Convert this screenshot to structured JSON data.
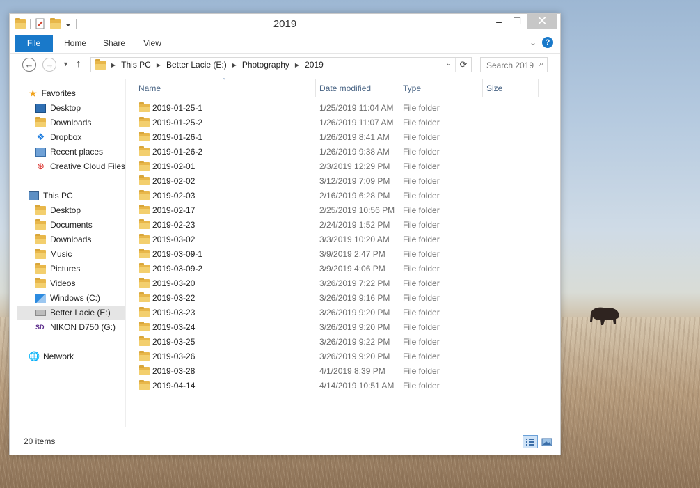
{
  "window": {
    "title": "2019",
    "minimize": "–",
    "maximize": "☐",
    "close": "✕"
  },
  "ribbon": {
    "tabs": [
      "File",
      "Home",
      "Share",
      "View"
    ],
    "accent": "#1979ca",
    "help": "?"
  },
  "nav": {
    "breadcrumbs": [
      "This PC",
      "Better Lacie (E:)",
      "Photography",
      "2019"
    ],
    "search_placeholder": "Search 2019"
  },
  "sidebar": {
    "favorites_header": "Favorites",
    "favorites": [
      "Desktop",
      "Downloads",
      "Dropbox",
      "Recent places",
      "Creative Cloud Files"
    ],
    "thispc_header": "This PC",
    "thispc": [
      "Desktop",
      "Documents",
      "Downloads",
      "Music",
      "Pictures",
      "Videos",
      "Windows (C:)",
      "Better Lacie (E:)",
      "NIKON D750  (G:)"
    ],
    "selected": "Better Lacie (E:)",
    "network_header": "Network"
  },
  "columns": {
    "name": "Name",
    "date": "Date modified",
    "type": "Type",
    "size": "Size"
  },
  "files": [
    {
      "name": "2019-01-25-1",
      "date": "1/25/2019 11:04 AM",
      "type": "File folder"
    },
    {
      "name": "2019-01-25-2",
      "date": "1/26/2019 11:07 AM",
      "type": "File folder"
    },
    {
      "name": "2019-01-26-1",
      "date": "1/26/2019 8:41 AM",
      "type": "File folder"
    },
    {
      "name": "2019-01-26-2",
      "date": "1/26/2019 9:38 AM",
      "type": "File folder"
    },
    {
      "name": "2019-02-01",
      "date": "2/3/2019 12:29 PM",
      "type": "File folder"
    },
    {
      "name": "2019-02-02",
      "date": "3/12/2019 7:09 PM",
      "type": "File folder"
    },
    {
      "name": "2019-02-03",
      "date": "2/16/2019 6:28 PM",
      "type": "File folder"
    },
    {
      "name": "2019-02-17",
      "date": "2/25/2019 10:56 PM",
      "type": "File folder"
    },
    {
      "name": "2019-02-23",
      "date": "2/24/2019 1:52 PM",
      "type": "File folder"
    },
    {
      "name": "2019-03-02",
      "date": "3/3/2019 10:20 AM",
      "type": "File folder"
    },
    {
      "name": "2019-03-09-1",
      "date": "3/9/2019 2:47 PM",
      "type": "File folder"
    },
    {
      "name": "2019-03-09-2",
      "date": "3/9/2019 4:06 PM",
      "type": "File folder"
    },
    {
      "name": "2019-03-20",
      "date": "3/26/2019 7:22 PM",
      "type": "File folder"
    },
    {
      "name": "2019-03-22",
      "date": "3/26/2019 9:16 PM",
      "type": "File folder"
    },
    {
      "name": "2019-03-23",
      "date": "3/26/2019 9:20 PM",
      "type": "File folder"
    },
    {
      "name": "2019-03-24",
      "date": "3/26/2019 9:20 PM",
      "type": "File folder"
    },
    {
      "name": "2019-03-25",
      "date": "3/26/2019 9:22 PM",
      "type": "File folder"
    },
    {
      "name": "2019-03-26",
      "date": "3/26/2019 9:20 PM",
      "type": "File folder"
    },
    {
      "name": "2019-03-28",
      "date": "4/1/2019 8:39 PM",
      "type": "File folder"
    },
    {
      "name": "2019-04-14",
      "date": "4/14/2019 10:51 AM",
      "type": "File folder"
    }
  ],
  "status": {
    "count": "20 items"
  }
}
